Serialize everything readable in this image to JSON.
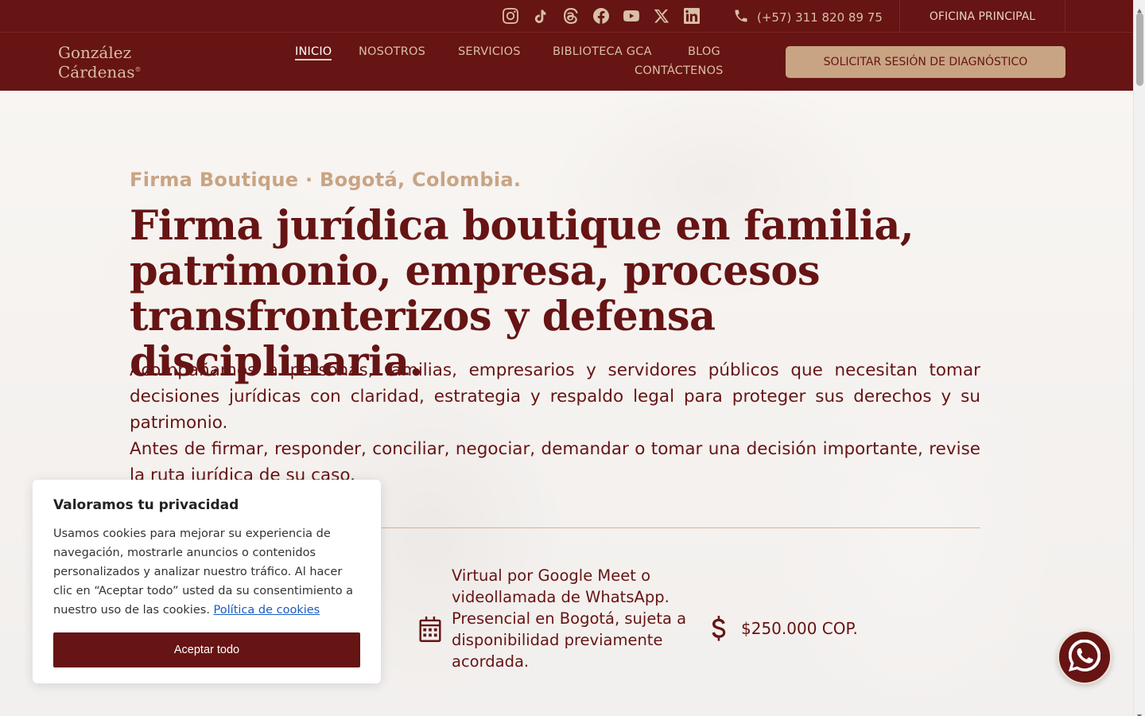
{
  "topbar": {
    "social_icons": [
      "instagram-icon",
      "tiktok-icon",
      "threads-icon",
      "facebook-icon",
      "youtube-icon",
      "x-icon",
      "linkedin-icon"
    ],
    "phone": "(+57) 311 820 89 75",
    "office_label": "OFICINA PRINCIPAL"
  },
  "brand": {
    "line1": "González",
    "line2": "Cárdenas",
    "mark": "®"
  },
  "nav": {
    "items": [
      {
        "label": "INICIO",
        "active": true
      },
      {
        "label": "NOSOTROS"
      },
      {
        "label": "SERVICIOS"
      },
      {
        "label": "BIBLIOTECA GCA"
      },
      {
        "label": "BLOG"
      },
      {
        "label": "CONTÁCTENOS"
      }
    ],
    "cta_label": "SOLICITAR SESIÓN DE DIAGNÓSTICO"
  },
  "hero": {
    "eyebrow": "Firma Boutique · Bogotá, Colombia.",
    "headline": "Firma jurídica boutique en familia, patrimonio, empresa, procesos transfronterizos y defensa disciplinaria.",
    "lead1": "Acompañamos a personas, familias, empresarios y servidores públicos que necesitan tomar decisiones jurídicas con claridad, estrategia y respaldo legal para proteger sus derechos y su patrimonio.",
    "lead2": "Antes de firmar, responder, conciliar, negociar, demandar o tomar una decisión importante, revise la ruta jurídica de su caso.",
    "modality": "Virtual por Google Meet o videollamada de WhatsApp. Presencial en Bogotá, sujeta a disponibilidad previamente acordada.",
    "price": "$250.000 COP."
  },
  "cookie": {
    "title": "Valoramos tu privacidad",
    "body": "Usamos cookies para mejorar su experiencia de navegación, mostrarle anuncios o contenidos personalizados y analizar nuestro tráfico. Al hacer clic en “Aceptar todo” usted da su consentimiento a nuestro uso de las cookies.",
    "link": "Política de cookies",
    "accept_label": "Aceptar todo"
  },
  "colors": {
    "brand": "#661414",
    "accent": "#c9a483",
    "link": "#1a5bc4"
  }
}
